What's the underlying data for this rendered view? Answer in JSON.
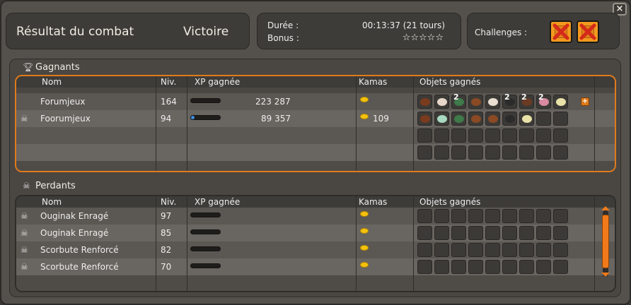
{
  "header": {
    "title": "Résultat du combat",
    "result": "Victoire",
    "duration_label": "Durée :",
    "duration_value": "00:13:37 (21 tours)",
    "bonus_label": "Bonus :",
    "bonus_stars": "☆☆☆☆☆",
    "challenges_label": "Challenges :"
  },
  "columns": {
    "name": "Nom",
    "level": "Niv.",
    "xp": "XP gagnée",
    "kamas": "Kamas",
    "items": "Objets gagnés"
  },
  "winners": {
    "title": "Gagnants",
    "rows": [
      {
        "name": "Forumjeux",
        "level": "164",
        "xp": "223 287",
        "xp_progress": 0.0,
        "kamas": "",
        "skull": false
      },
      {
        "name": "Foorumjeux",
        "level": "94",
        "xp": "89 357",
        "xp_progress": 0.12,
        "kamas": "109",
        "skull": true
      }
    ]
  },
  "losers": {
    "title": "Perdants",
    "rows": [
      {
        "name": "Ouginak Enragé",
        "level": "97"
      },
      {
        "name": "Ouginak Enragé",
        "level": "85"
      },
      {
        "name": "Scorbute Renforcé",
        "level": "82"
      },
      {
        "name": "Scorbute Renforcé",
        "level": "70"
      }
    ]
  },
  "winner_items": {
    "row1": [
      {
        "icon": "leather-strap-icon",
        "color": "#7a3b1e",
        "qty": ""
      },
      {
        "icon": "meat-icon",
        "color": "#e8d6c8",
        "qty": ""
      },
      {
        "icon": "green-fish-icon",
        "color": "#3f7a4a",
        "qty": "2"
      },
      {
        "icon": "pelt-icon",
        "color": "#8a4a24",
        "qty": ""
      },
      {
        "icon": "claw-icon",
        "color": "#e9ded0",
        "qty": ""
      },
      {
        "icon": "tail-icon",
        "color": "#2b2b2b",
        "qty": "2"
      },
      {
        "icon": "hide-icon",
        "color": "#6a3a22",
        "qty": "2"
      },
      {
        "icon": "pink-creature-icon",
        "color": "#d98aa0",
        "qty": "2"
      },
      {
        "icon": "bone-icon",
        "color": "#e8e2a8",
        "qty": ""
      }
    ],
    "row2": [
      {
        "icon": "leather-strap-icon",
        "color": "#7a3b1e",
        "qty": ""
      },
      {
        "icon": "feather-icon",
        "color": "#a8d8c0",
        "qty": ""
      },
      {
        "icon": "green-fish-icon",
        "color": "#3f7a4a",
        "qty": ""
      },
      {
        "icon": "pelt-icon",
        "color": "#8a4a24",
        "qty": ""
      },
      {
        "icon": "wing-icon",
        "color": "#8a4a24",
        "qty": ""
      },
      {
        "icon": "tail-icon",
        "color": "#2b2b2b",
        "qty": ""
      },
      {
        "icon": "bone-icon",
        "color": "#e8e2a8",
        "qty": ""
      }
    ]
  }
}
